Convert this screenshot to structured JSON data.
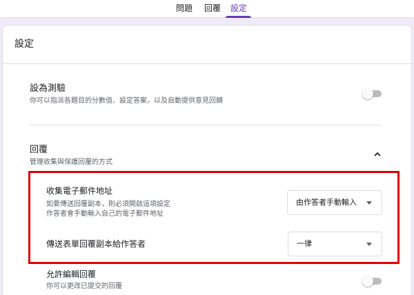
{
  "tabs": [
    {
      "label": "問題"
    },
    {
      "label": "回覆"
    },
    {
      "label": "設定",
      "active": true
    }
  ],
  "settings_title": "設定",
  "quiz": {
    "title": "設為測驗",
    "description": "你可以指派各題目的分數值、設定答案，以及自動提供意見回饋",
    "enabled": false
  },
  "responses": {
    "title": "回覆",
    "description": "管理收集與保護回覆的方式",
    "expanded": true,
    "collect_email": {
      "title": "收集電子郵件地址",
      "desc_line1": "如要傳送回覆副本，則必須開啟這項設定",
      "desc_line2": "作答者會手動輸入自己的電子郵件地址",
      "value": "由作答者手動輸入"
    },
    "send_copy": {
      "title": "傳送表單回覆副本給作答者",
      "value": "一律"
    },
    "allow_edit": {
      "title": "允許編輯回覆",
      "description": "你可以更改已提交的回覆",
      "enabled": false
    }
  },
  "colors": {
    "accent": "#673ab7",
    "background": "#f0ebf8",
    "highlight_border": "#e00000"
  },
  "icons": [
    "chevron-up-icon",
    "dropdown-arrow-icon"
  ]
}
